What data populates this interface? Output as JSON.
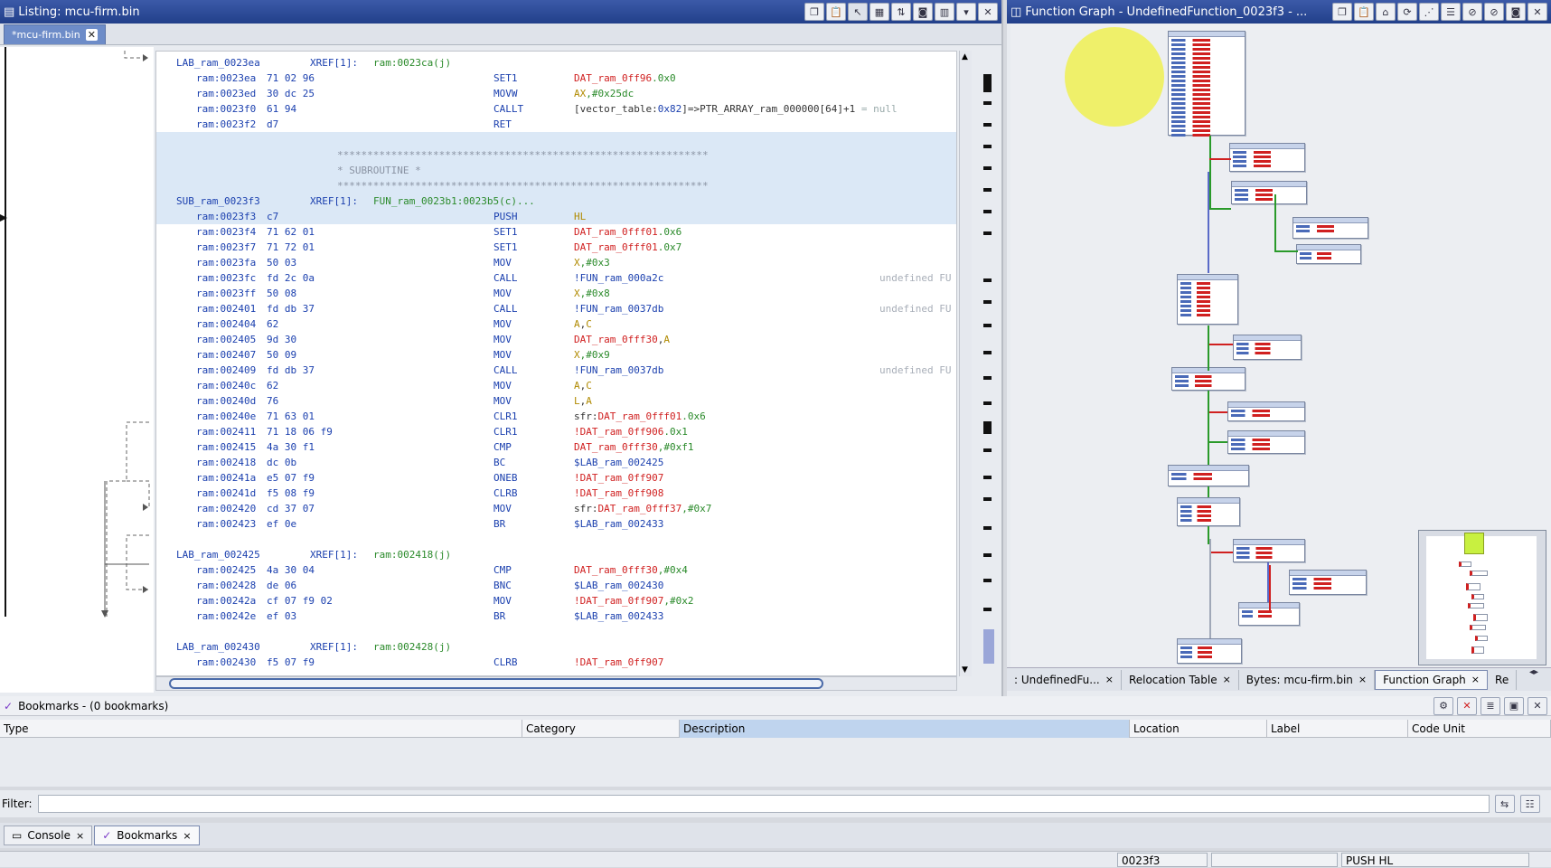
{
  "listing": {
    "title": "Listing: mcu-firm.bin",
    "tab_label": "*mcu-firm.bin",
    "rows": [
      {
        "type": "label",
        "label": "LAB_ram_0023ea",
        "xref": "XREF[1]:",
        "xref_val": "ram:0023ca(j)"
      },
      {
        "type": "code",
        "addr": "ram:0023ea",
        "bytes": "71 02 96",
        "mnemonic": "SET1",
        "op": [
          {
            "t": "DAT_ram_0ff96",
            "c": "r"
          },
          {
            "t": ".0x0",
            "c": "g"
          }
        ]
      },
      {
        "type": "code",
        "addr": "ram:0023ed",
        "bytes": "30 dc 25",
        "mnemonic": "MOVW",
        "op": [
          {
            "t": "AX",
            "c": "o"
          },
          {
            "t": ",#0x25dc",
            "c": "g"
          }
        ]
      },
      {
        "type": "code",
        "addr": "ram:0023f0",
        "bytes": "61 94",
        "mnemonic": "CALLT",
        "op": [
          {
            "t": "[vector_table:",
            "c": ""
          },
          {
            "t": "0x82",
            "c": "b"
          },
          {
            "t": "]=>PTR_ARRAY_ram_000000[64]+1",
            "c": ""
          },
          {
            "t": "  = null",
            "c": "gray"
          }
        ]
      },
      {
        "type": "code",
        "addr": "ram:0023f2",
        "bytes": "d7",
        "mnemonic": "RET",
        "op": []
      },
      {
        "type": "blank",
        "hl": true
      },
      {
        "type": "banner",
        "text": "**************************************************************",
        "hl": true
      },
      {
        "type": "banner",
        "text": "*                        SUBROUTINE                          *",
        "hl": true
      },
      {
        "type": "banner",
        "text": "**************************************************************",
        "hl": true
      },
      {
        "type": "label",
        "label": "SUB_ram_0023f3",
        "xref": "XREF[1]:",
        "xref_val": "FUN_ram_0023b1:0023b5(c)...",
        "hl": true
      },
      {
        "type": "code",
        "addr": "ram:0023f3",
        "bytes": "c7",
        "mnemonic": "PUSH",
        "op": [
          {
            "t": "HL",
            "c": "o"
          }
        ],
        "hl": true
      },
      {
        "type": "code",
        "addr": "ram:0023f4",
        "bytes": "71 62 01",
        "mnemonic": "SET1",
        "op": [
          {
            "t": "DAT_ram_0fff01",
            "c": "r"
          },
          {
            "t": ".0x6",
            "c": "g"
          }
        ]
      },
      {
        "type": "code",
        "addr": "ram:0023f7",
        "bytes": "71 72 01",
        "mnemonic": "SET1",
        "op": [
          {
            "t": "DAT_ram_0fff01",
            "c": "r"
          },
          {
            "t": ".0x7",
            "c": "g"
          }
        ]
      },
      {
        "type": "code",
        "addr": "ram:0023fa",
        "bytes": "50 03",
        "mnemonic": "MOV",
        "op": [
          {
            "t": "X",
            "c": "o"
          },
          {
            "t": ",#0x3",
            "c": "g"
          }
        ]
      },
      {
        "type": "code",
        "addr": "ram:0023fc",
        "bytes": "fd 2c 0a",
        "mnemonic": "CALL",
        "op": [
          {
            "t": "!FUN_ram_000a2c",
            "c": "b"
          }
        ],
        "tail": "undefined FU"
      },
      {
        "type": "code",
        "addr": "ram:0023ff",
        "bytes": "50 08",
        "mnemonic": "MOV",
        "op": [
          {
            "t": "X",
            "c": "o"
          },
          {
            "t": ",#0x8",
            "c": "g"
          }
        ]
      },
      {
        "type": "code",
        "addr": "ram:002401",
        "bytes": "fd db 37",
        "mnemonic": "CALL",
        "op": [
          {
            "t": "!FUN_ram_0037db",
            "c": "b"
          }
        ],
        "tail": "undefined FU"
      },
      {
        "type": "code",
        "addr": "ram:002404",
        "bytes": "62",
        "mnemonic": "MOV",
        "op": [
          {
            "t": "A",
            "c": "o"
          },
          {
            "t": ",",
            "c": ""
          },
          {
            "t": "C",
            "c": "o"
          }
        ]
      },
      {
        "type": "code",
        "addr": "ram:002405",
        "bytes": "9d 30",
        "mnemonic": "MOV",
        "op": [
          {
            "t": "DAT_ram_0fff30",
            "c": "r"
          },
          {
            "t": ",",
            "c": ""
          },
          {
            "t": "A",
            "c": "o"
          }
        ]
      },
      {
        "type": "code",
        "addr": "ram:002407",
        "bytes": "50 09",
        "mnemonic": "MOV",
        "op": [
          {
            "t": "X",
            "c": "o"
          },
          {
            "t": ",#0x9",
            "c": "g"
          }
        ]
      },
      {
        "type": "code",
        "addr": "ram:002409",
        "bytes": "fd db 37",
        "mnemonic": "CALL",
        "op": [
          {
            "t": "!FUN_ram_0037db",
            "c": "b"
          }
        ],
        "tail": "undefined FU"
      },
      {
        "type": "code",
        "addr": "ram:00240c",
        "bytes": "62",
        "mnemonic": "MOV",
        "op": [
          {
            "t": "A",
            "c": "o"
          },
          {
            "t": ",",
            "c": ""
          },
          {
            "t": "C",
            "c": "o"
          }
        ]
      },
      {
        "type": "code",
        "addr": "ram:00240d",
        "bytes": "76",
        "mnemonic": "MOV",
        "op": [
          {
            "t": "L",
            "c": "o"
          },
          {
            "t": ",",
            "c": ""
          },
          {
            "t": "A",
            "c": "o"
          }
        ]
      },
      {
        "type": "code",
        "addr": "ram:00240e",
        "bytes": "71 63 01",
        "mnemonic": "CLR1",
        "op": [
          {
            "t": "sfr:",
            "c": ""
          },
          {
            "t": "DAT_ram_0fff01",
            "c": "r"
          },
          {
            "t": ".0x6",
            "c": "g"
          }
        ]
      },
      {
        "type": "code",
        "addr": "ram:002411",
        "bytes": "71 18 06 f9",
        "mnemonic": "CLR1",
        "op": [
          {
            "t": "!DAT_ram_0ff906",
            "c": "r"
          },
          {
            "t": ".0x1",
            "c": "g"
          }
        ]
      },
      {
        "type": "code",
        "addr": "ram:002415",
        "bytes": "4a 30 f1",
        "mnemonic": "CMP",
        "op": [
          {
            "t": "DAT_ram_0fff30",
            "c": "r"
          },
          {
            "t": ",#0xf1",
            "c": "g"
          }
        ]
      },
      {
        "type": "code",
        "addr": "ram:002418",
        "bytes": "dc 0b",
        "mnemonic": "BC",
        "op": [
          {
            "t": "$LAB_ram_002425",
            "c": "b"
          }
        ]
      },
      {
        "type": "code",
        "addr": "ram:00241a",
        "bytes": "e5 07 f9",
        "mnemonic": "ONEB",
        "op": [
          {
            "t": "!DAT_ram_0ff907",
            "c": "r"
          }
        ]
      },
      {
        "type": "code",
        "addr": "ram:00241d",
        "bytes": "f5 08 f9",
        "mnemonic": "CLRB",
        "op": [
          {
            "t": "!DAT_ram_0ff908",
            "c": "r"
          }
        ]
      },
      {
        "type": "code",
        "addr": "ram:002420",
        "bytes": "cd 37 07",
        "mnemonic": "MOV",
        "op": [
          {
            "t": "sfr:",
            "c": ""
          },
          {
            "t": "DAT_ram_0fff37",
            "c": "r"
          },
          {
            "t": ",#0x7",
            "c": "g"
          }
        ]
      },
      {
        "type": "code",
        "addr": "ram:002423",
        "bytes": "ef 0e",
        "mnemonic": "BR",
        "op": [
          {
            "t": "$LAB_ram_002433",
            "c": "b"
          }
        ]
      },
      {
        "type": "blank"
      },
      {
        "type": "label",
        "label": "LAB_ram_002425",
        "xref": "XREF[1]:",
        "xref_val": "ram:002418(j)"
      },
      {
        "type": "code",
        "addr": "ram:002425",
        "bytes": "4a 30 04",
        "mnemonic": "CMP",
        "op": [
          {
            "t": "DAT_ram_0fff30",
            "c": "r"
          },
          {
            "t": ",#0x4",
            "c": "g"
          }
        ]
      },
      {
        "type": "code",
        "addr": "ram:002428",
        "bytes": "de 06",
        "mnemonic": "BNC",
        "op": [
          {
            "t": "$LAB_ram_002430",
            "c": "b"
          }
        ]
      },
      {
        "type": "code",
        "addr": "ram:00242a",
        "bytes": "cf 07 f9 02",
        "mnemonic": "MOV",
        "op": [
          {
            "t": "!DAT_ram_0ff907",
            "c": "r"
          },
          {
            "t": ",#0x2",
            "c": "g"
          }
        ]
      },
      {
        "type": "code",
        "addr": "ram:00242e",
        "bytes": "ef 03",
        "mnemonic": "BR",
        "op": [
          {
            "t": "$LAB_ram_002433",
            "c": "b"
          }
        ]
      },
      {
        "type": "blank"
      },
      {
        "type": "label",
        "label": "LAB_ram_002430",
        "xref": "XREF[1]:",
        "xref_val": "ram:002428(j)"
      },
      {
        "type": "code",
        "addr": "ram:002430",
        "bytes": "f5 07 f9",
        "mnemonic": "CLRB",
        "op": [
          {
            "t": "!DAT_ram_0ff907",
            "c": "r"
          }
        ]
      }
    ]
  },
  "graph": {
    "title": "Function Graph - UndefinedFunction_0023f3 - ...",
    "tabs": [
      {
        "label": ": UndefinedFu...",
        "close": "×",
        "active": false
      },
      {
        "label": "Relocation Table",
        "close": "×",
        "active": false
      },
      {
        "label": "Bytes: mcu-firm.bin",
        "close": "×",
        "active": false
      },
      {
        "label": "Function Graph",
        "close": "×",
        "active": true
      },
      {
        "label": "Re",
        "close": "",
        "active": false
      }
    ]
  },
  "bookmarks": {
    "title": "Bookmarks - (0 bookmarks)",
    "columns": [
      "Type",
      "Category",
      "Description",
      "Location",
      "Label",
      "Code Unit"
    ],
    "sorted_column": "Description"
  },
  "filter": {
    "label": "Filter:",
    "value": ""
  },
  "bottom_tabs": [
    {
      "label": "Console",
      "close": "×",
      "active": false
    },
    {
      "label": "Bookmarks",
      "close": "×",
      "active": true
    }
  ],
  "status": {
    "address": "0023f3",
    "instruction": "PUSH HL"
  },
  "colors": {
    "accent": "#22408a",
    "highlight_row": "#dbe8f6",
    "graph_highlight": "#f0f03c"
  }
}
